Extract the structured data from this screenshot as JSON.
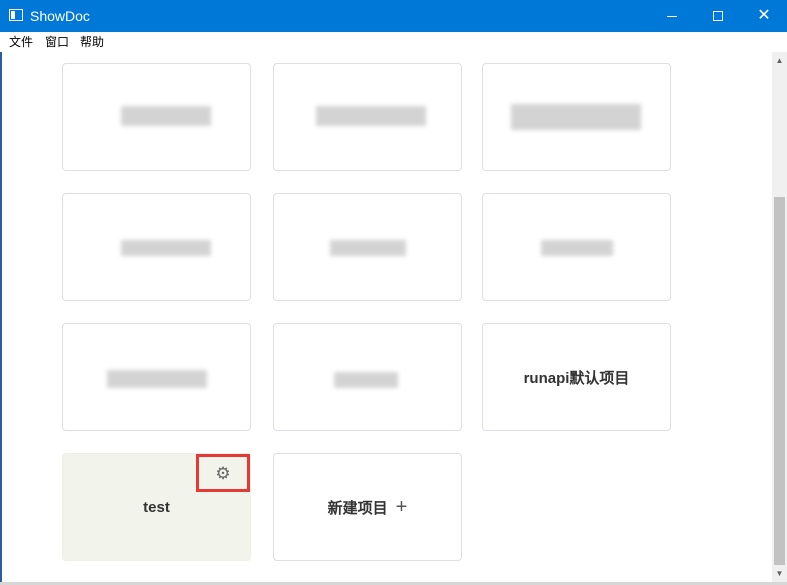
{
  "window": {
    "title": "ShowDoc"
  },
  "menu": {
    "items": [
      "文件",
      "窗口",
      "帮助"
    ]
  },
  "projects": [
    {
      "name": "",
      "redacted": true
    },
    {
      "name": "",
      "redacted": true
    },
    {
      "name": "",
      "redacted": true
    },
    {
      "name": "",
      "redacted": true
    },
    {
      "name": "",
      "redacted": true
    },
    {
      "name": "",
      "redacted": true
    },
    {
      "name": "",
      "redacted": true
    },
    {
      "name": "",
      "redacted": true
    },
    {
      "name": "runapi默认项目"
    },
    {
      "name": "test",
      "highlighted": true
    }
  ],
  "new_project": {
    "label": "新建项目",
    "icon": "plus-icon"
  },
  "colors": {
    "titlebar": "#0078d7",
    "highlight_border": "#e53935",
    "test_card_bg": "#f2f4ec"
  },
  "icons": {
    "settings": "gear-icon"
  }
}
